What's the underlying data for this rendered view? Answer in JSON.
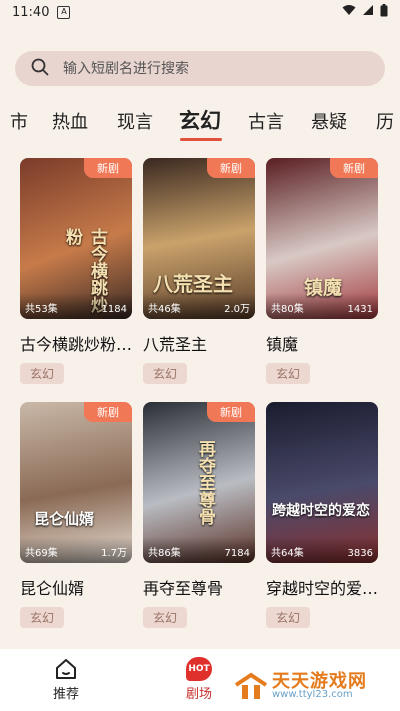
{
  "status": {
    "time": "11:40",
    "app_icon_letter": "A"
  },
  "search": {
    "placeholder": "输入短剧名进行搜索"
  },
  "tabs": [
    {
      "label": "市"
    },
    {
      "label": "热血"
    },
    {
      "label": "现言"
    },
    {
      "label": "玄幻",
      "active": true
    },
    {
      "label": "古言"
    },
    {
      "label": "悬疑"
    },
    {
      "label": "历"
    }
  ],
  "cards": [
    {
      "title": "古今横跳炒粉…",
      "badge": "新剧",
      "episodes": "共53集",
      "count": "1184",
      "genre": "玄幻",
      "art_text": "古今横跳炒粉",
      "colors": [
        "#7a3b2a",
        "#c77b4a",
        "#3a2a25"
      ]
    },
    {
      "title": "八荒圣主",
      "badge": "新剧",
      "episodes": "共46集",
      "count": "2.0万",
      "genre": "玄幻",
      "art_text": "八荒圣主",
      "colors": [
        "#3a2820",
        "#c9a26b",
        "#5a3d2a"
      ]
    },
    {
      "title": "镇魔",
      "badge": "新剧",
      "episodes": "共80集",
      "count": "1431",
      "genre": "玄幻",
      "art_text": "镇魔",
      "colors": [
        "#5a1e22",
        "#d8c9c5",
        "#a33a3d"
      ]
    },
    {
      "title": "昆仑仙婿",
      "badge": "新剧",
      "episodes": "共69集",
      "count": "1.7万",
      "genre": "玄幻",
      "art_text": "昆仑仙婿",
      "colors": [
        "#c9b8a8",
        "#8a6a55",
        "#e6dcd2"
      ]
    },
    {
      "title": "再夺至尊骨",
      "badge": "新剧",
      "episodes": "共86集",
      "count": "7184",
      "genre": "玄幻",
      "art_text": "再夺至尊骨",
      "colors": [
        "#2a2e35",
        "#b9bcc2",
        "#5a3025"
      ]
    },
    {
      "title": "穿越时空的爱…",
      "badge": "",
      "episodes": "共64集",
      "count": "3836",
      "genre": "玄幻",
      "art_text": "跨越时空的爱恋",
      "colors": [
        "#1a1c2e",
        "#4a4a6a",
        "#8a3030"
      ]
    }
  ],
  "bottom_nav": [
    {
      "label": "推荐",
      "icon": "home-icon"
    },
    {
      "label": "剧场",
      "icon": "hot-icon",
      "badge_text": "HOT",
      "active": true
    }
  ],
  "watermark": {
    "title": "天天游戏网",
    "url": "www.ttyl23.com"
  },
  "accent_color": "#e0523d"
}
